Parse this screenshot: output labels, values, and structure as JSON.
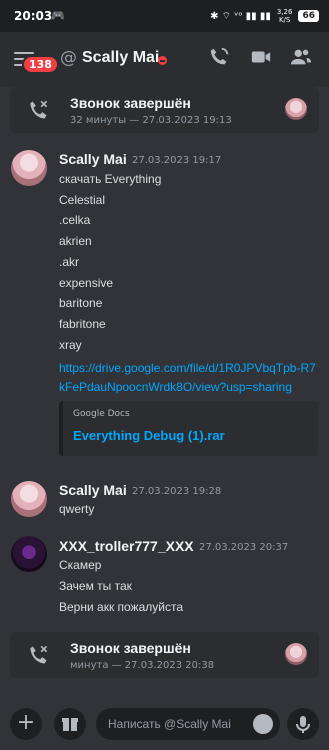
{
  "status": {
    "time": "20:03",
    "icons": "✱ ⌔ ᵛᵒ ▮▮ ▮▮",
    "speed": "3,26",
    "speed_unit": "K/S",
    "battery": "66"
  },
  "header": {
    "badge": "138",
    "channel": "Scally Mai"
  },
  "calls": [
    {
      "title": "Звонок завершён",
      "sub": "32 минуты — 27.03.2023 19:13"
    },
    {
      "title": "Звонок завершён",
      "sub": "минута — 27.03.2023 20:38"
    }
  ],
  "messages": [
    {
      "author": "Scally Mai",
      "time": "27.03.2023 19:17",
      "lines": [
        "скачать Everything",
        "Celestial",
        ".celka",
        "akrien",
        ".akr",
        "expensive",
        "baritone",
        "fabritone",
        "xray"
      ],
      "link": "https://drive.google.com/file/d/1R0JPVbqTpb-R7kFePdauNpoocnWrdk8O/view?usp=sharing",
      "embed": {
        "provider": "Google Docs",
        "title": "Everything Debug (1).rar"
      }
    },
    {
      "author": "Scally Mai",
      "time": "27.03.2023 19:28",
      "lines": [
        "qwerty"
      ]
    },
    {
      "author": "XXX_troller777_XXX",
      "time": "27.03.2023 20:37",
      "lines": [
        "Скамер",
        "Зачем ты так",
        "Верни акк пожалуйста"
      ]
    }
  ],
  "composer": {
    "placeholder": "Написать @Scally Mai"
  },
  "colors": {
    "background": "#313338",
    "link": "#00a8fc",
    "dnd": "#f23f43"
  }
}
